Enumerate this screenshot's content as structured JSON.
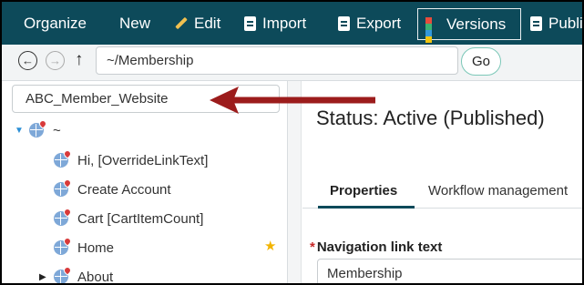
{
  "toolbar": {
    "organize": "Organize",
    "new": "New",
    "edit": "Edit",
    "import": "Import",
    "export": "Export",
    "versions": "Versions",
    "publish": "Publi",
    "versions_grid_colors": [
      "#e74c3c",
      "#3cb371",
      "#3498db",
      "#f1c40f"
    ]
  },
  "address": {
    "path": "~/Membership",
    "go": "Go"
  },
  "tree": {
    "site": "ABC_Member_Website",
    "root": "~",
    "items": [
      {
        "label": "Hi, [OverrideLinkText]"
      },
      {
        "label": "Create Account"
      },
      {
        "label": "Cart [CartItemCount]"
      },
      {
        "label": "Home"
      },
      {
        "label": "About"
      }
    ],
    "star_icon": "★"
  },
  "content": {
    "status": "Status: Active (Published)",
    "tabs": [
      "Properties",
      "Workflow management"
    ],
    "field_label": "Navigation link text",
    "required_marker": "*",
    "field_value": "Membership"
  },
  "colors": {
    "toolbar_bg": "#0d4a5a",
    "annotation_arrow": "#9c1c1c",
    "favorite_star": "#f2b400",
    "required": "#c62828"
  }
}
